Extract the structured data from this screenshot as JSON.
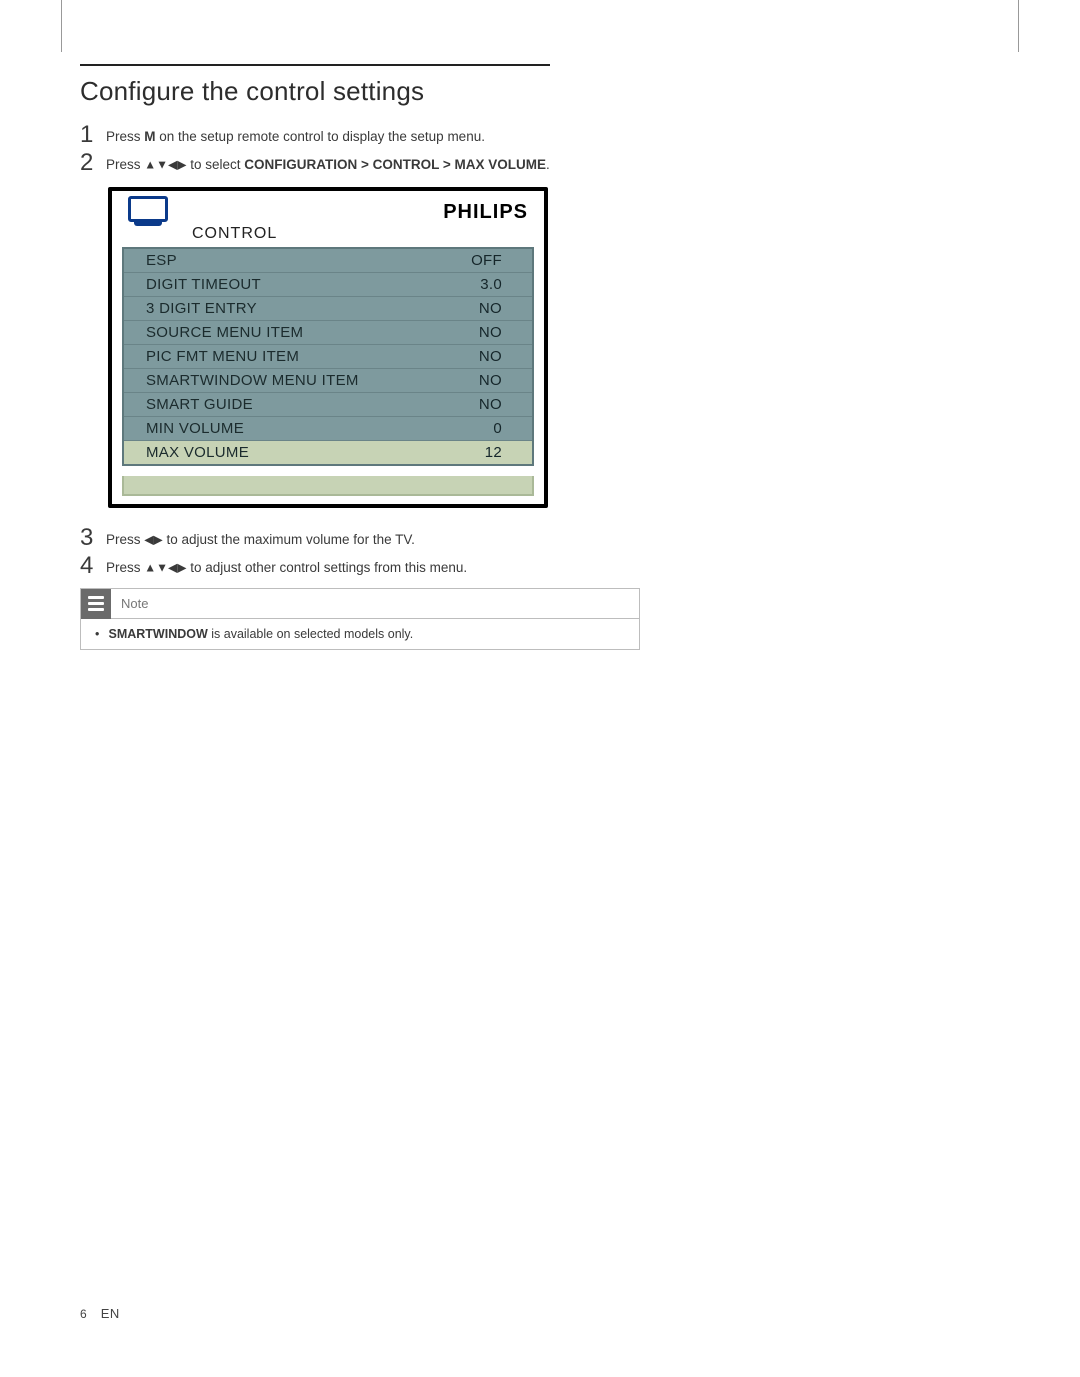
{
  "section": {
    "title": "Configure the control settings"
  },
  "steps": {
    "s1": {
      "num": "1",
      "text_a": "Press ",
      "key": "M",
      "text_b": " on the setup remote control to display the setup menu."
    },
    "s2": {
      "num": "2",
      "text_a": "Press ",
      "arrows": "▲▼◀▶",
      "text_b": " to select ",
      "path": "CONFIGURATION > CONTROL > MAX VOLUME",
      "text_c": "."
    },
    "s3": {
      "num": "3",
      "text_a": "Press ",
      "arrows": "◀▶",
      "text_b": " to adjust the maximum volume for the TV."
    },
    "s4": {
      "num": "4",
      "text_a": "Press ",
      "arrows": "▲▼◀▶",
      "text_b": " to adjust other control settings from this menu."
    }
  },
  "osd": {
    "brand": "PHILIPS",
    "title": "CONTROL",
    "rows": [
      {
        "label": "ESP",
        "value": "OFF"
      },
      {
        "label": "DIGIT TIMEOUT",
        "value": "3.0"
      },
      {
        "label": "3 DIGIT ENTRY",
        "value": "NO"
      },
      {
        "label": "SOURCE MENU ITEM",
        "value": "NO"
      },
      {
        "label": "PIC FMT MENU ITEM",
        "value": "NO"
      },
      {
        "label": "SMARTWINDOW MENU ITEM",
        "value": "NO"
      },
      {
        "label": "SMART GUIDE",
        "value": "NO"
      },
      {
        "label": "MIN VOLUME",
        "value": "0"
      },
      {
        "label": "MAX VOLUME",
        "value": "12",
        "highlight": true
      }
    ]
  },
  "note": {
    "label": "Note",
    "body_strong": "SMARTWINDOW",
    "body_rest": " is available on selected models only."
  },
  "footer": {
    "page": "6",
    "lang": "EN"
  }
}
